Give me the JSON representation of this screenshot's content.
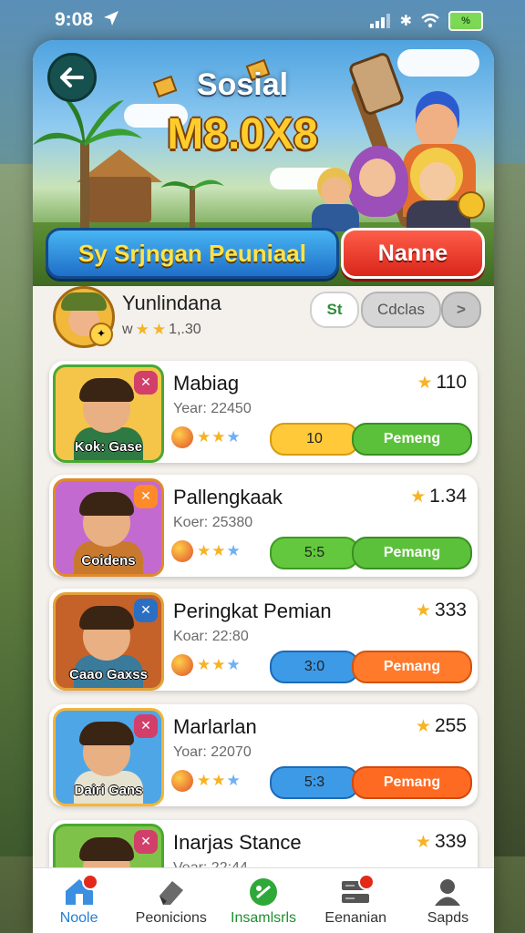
{
  "status": {
    "time": "9:08",
    "battery": "%"
  },
  "header": {
    "title": "Sosial",
    "subtitle": "M8.0X8",
    "primary_button": "Sy Srjngan Peuniaal",
    "secondary_button": "Nanne"
  },
  "profile": {
    "name": "Yunlindana",
    "meta_prefix": "w",
    "meta_value": "1,.30",
    "pill_st": "St",
    "pill_class": "Cdclas",
    "pill_next": ">"
  },
  "list": [
    {
      "title": "Mabiag",
      "year": "Year: 22450",
      "score": "110",
      "caption": "Kok: Gase",
      "seg_a": "10",
      "seg_b": "Pemeng",
      "thumb_bg": "#f5c54a",
      "thumb_border": "#4aa832",
      "corner": "#d23f6a",
      "seg_a_bg": "#ffc93a",
      "seg_a_border": "#d99a10",
      "seg_b_bg": "#5cc13a",
      "seg_b_border": "#3a8f22",
      "body": "#2f7a44"
    },
    {
      "title": "Pallengkaak",
      "year": "Koer: 25380",
      "score": "1.34",
      "caption": "Coidens",
      "seg_a": "5:5",
      "seg_b": "Pemang",
      "thumb_bg": "#c36ad0",
      "thumb_border": "#e08a2a",
      "corner": "#ff8a2a",
      "seg_a_bg": "#63c83e",
      "seg_a_border": "#3e9a22",
      "seg_b_bg": "#5cc13a",
      "seg_b_border": "#3a8f22",
      "body": "#c9792e"
    },
    {
      "title": "Peringkat Pemian",
      "year": "Koar: 22:80",
      "score": "333",
      "caption": "Caao Gaxss",
      "seg_a": "3:0",
      "seg_b": "Pemang",
      "thumb_bg": "#c4622a",
      "thumb_border": "#e5a23a",
      "corner": "#2a6fc4",
      "seg_a_bg": "#3d9ae6",
      "seg_a_border": "#1c6ab8",
      "seg_b_bg": "#ff7a2a",
      "seg_b_border": "#d2540e",
      "body": "#3a7a9a"
    },
    {
      "title": "Marlarlan",
      "year": "Yoar: 22070",
      "score": "255",
      "caption": "Dairi Gans",
      "seg_a": "5:3",
      "seg_b": "Pemang",
      "thumb_bg": "#4fa6e6",
      "thumb_border": "#f2b53a",
      "corner": "#d23f6a",
      "seg_a_bg": "#3d9ae6",
      "seg_a_border": "#1c6ab8",
      "seg_b_bg": "#ff6a22",
      "seg_b_border": "#d2480e",
      "body": "#e6e2d0"
    },
    {
      "title": "Inarjas Stance",
      "year": "Vear: 22:44",
      "score": "339",
      "caption": "",
      "seg_a": "",
      "seg_b": "",
      "thumb_bg": "#7fc24a",
      "thumb_border": "#4aa832",
      "corner": "#d23f6a",
      "seg_a_bg": "#3d9ae6",
      "seg_a_border": "#1c6ab8",
      "seg_b_bg": "#ff6a22",
      "seg_b_border": "#d2480e",
      "body": "#2f7a44"
    }
  ],
  "tabs": [
    {
      "label": "Noole",
      "icon": "home-icon"
    },
    {
      "label": "Peonicions",
      "icon": "eraser-icon"
    },
    {
      "label": "Insamlsrls",
      "icon": "leaf-icon"
    },
    {
      "label": "Eenanian",
      "icon": "server-icon"
    },
    {
      "label": "Sapds",
      "icon": "user-icon"
    }
  ]
}
